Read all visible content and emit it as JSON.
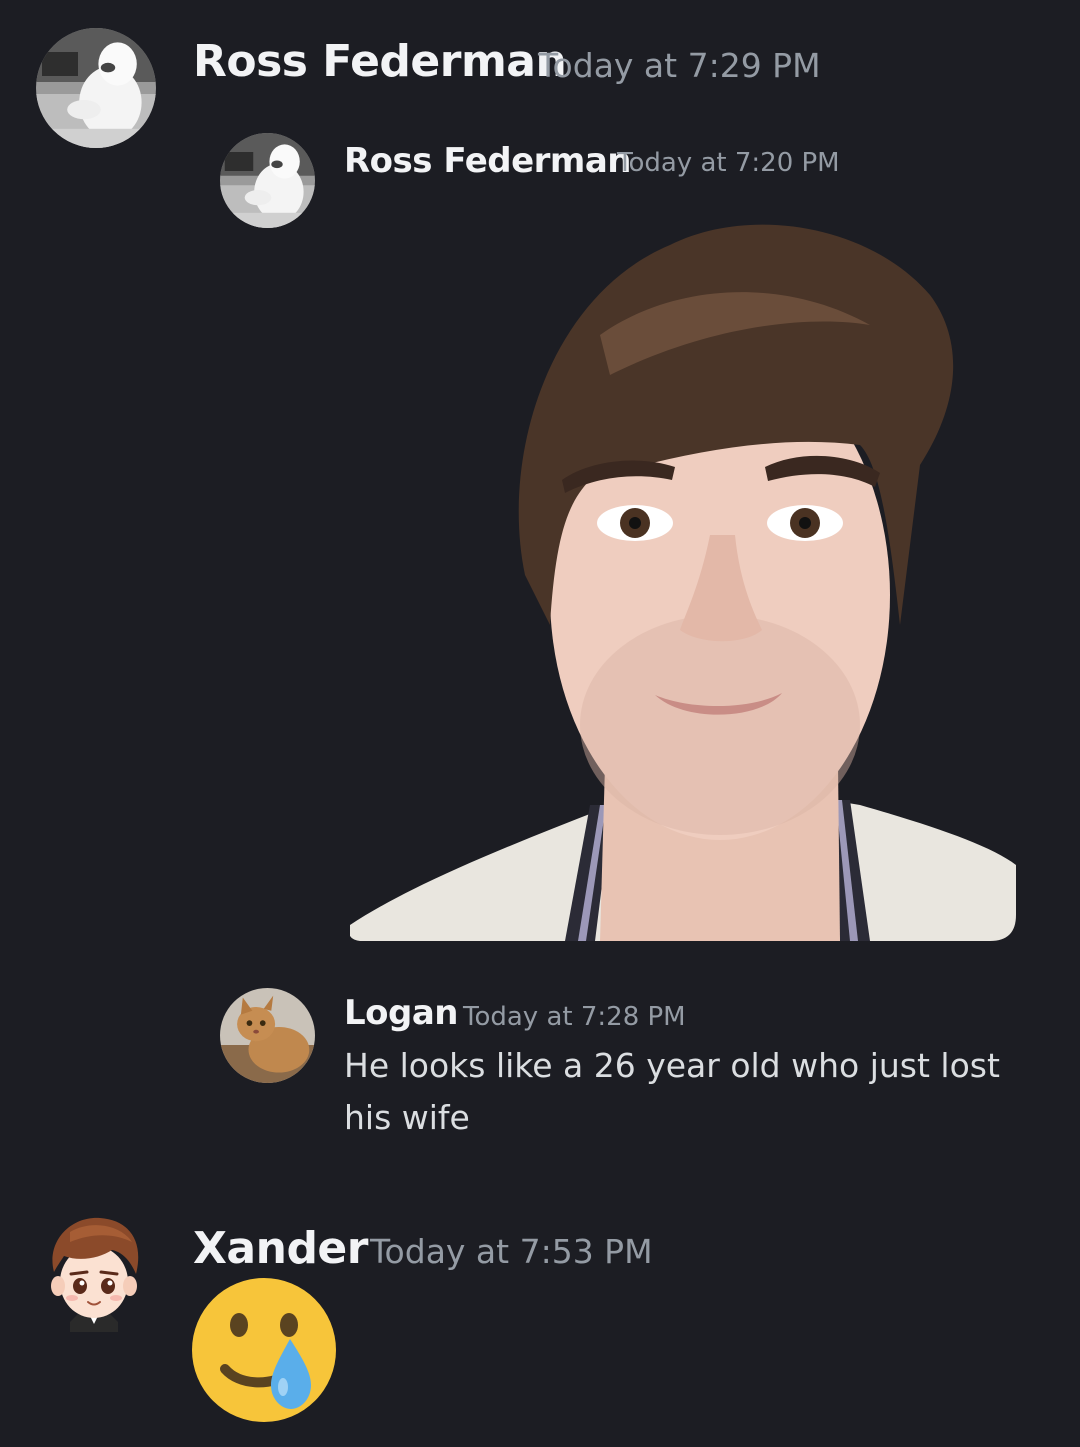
{
  "messages": [
    {
      "username": "Ross Federman",
      "timestamp": "Today at 7:29 PM",
      "avatar": "white-gorilla-costume-avatar"
    },
    {
      "username": "Ross Federman",
      "timestamp": "Today at 7:20 PM",
      "avatar": "white-gorilla-costume-avatar",
      "attachment": "cutout-selfie-photo"
    },
    {
      "username": "Logan",
      "timestamp": "Today at 7:28 PM",
      "avatar": "orange-cat-avatar",
      "text": "He looks like a 26 year old who just lost his wife"
    },
    {
      "username": "Xander",
      "timestamp": "Today at 7:53 PM",
      "avatar": "cartoon-boy-avatar",
      "emoji": "smiling-face-with-tear-emoji"
    }
  ],
  "colors": {
    "background": "#1c1d23",
    "username": "#f2f3f5",
    "timestamp": "#949ba4",
    "text": "#dbdee1"
  }
}
